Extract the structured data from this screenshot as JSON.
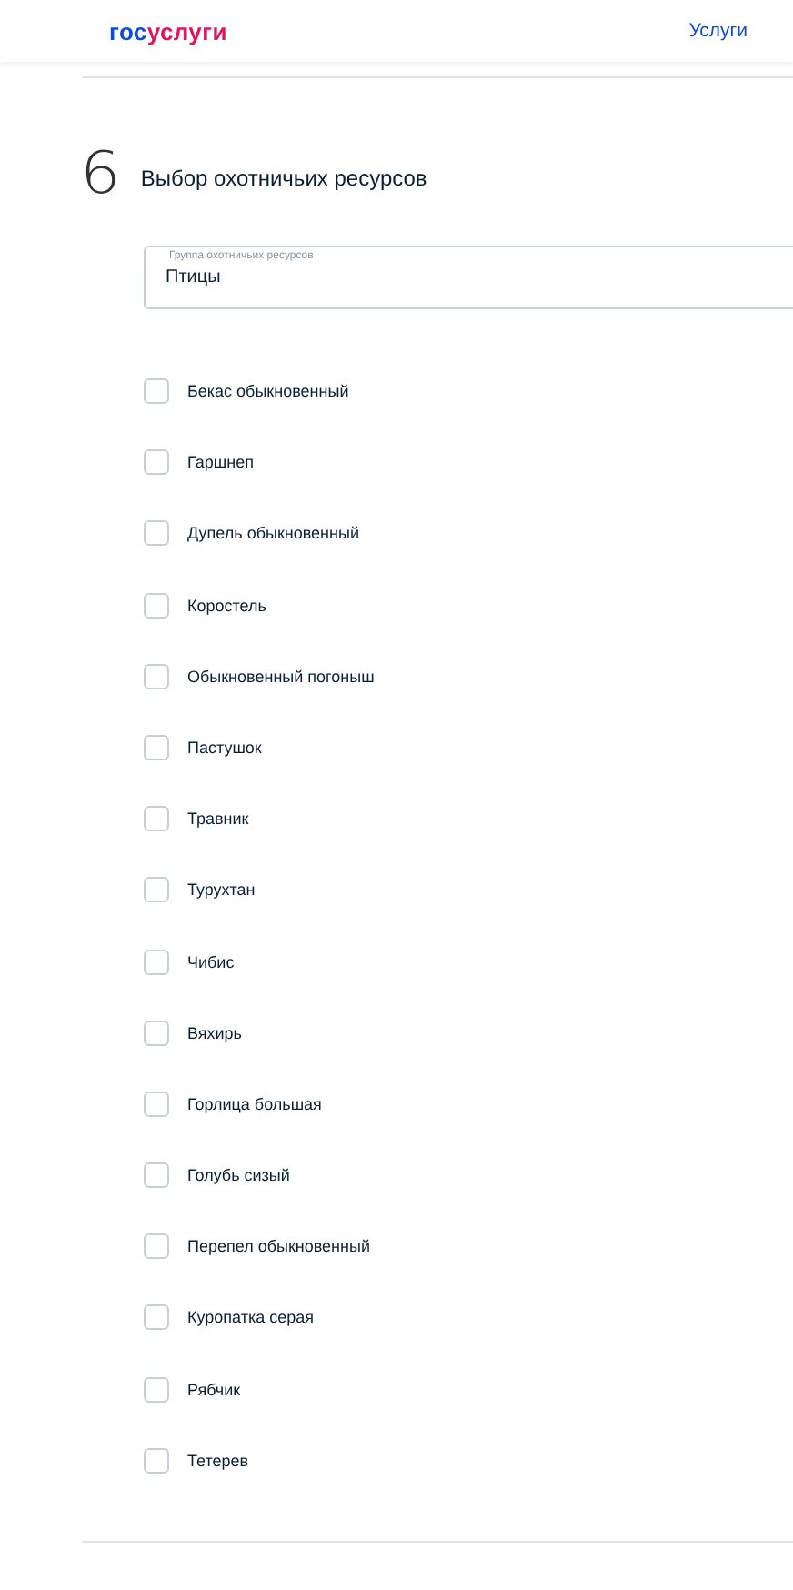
{
  "header": {
    "logo_prefix": "гос",
    "logo_suffix": "услуги",
    "nav_link": "Услуги"
  },
  "step": {
    "number": "6",
    "title": "Выбор охотничьих ресурсов"
  },
  "group_field": {
    "label": "Группа охотничьих ресурсов",
    "value": "Птицы"
  },
  "options": [
    {
      "label": "Бекас обыкновенный",
      "checked": false
    },
    {
      "label": "Гаршнеп",
      "checked": false
    },
    {
      "label": "Дупель обыкновенный",
      "checked": false
    },
    {
      "label": "Коростель",
      "checked": false
    },
    {
      "label": "Обыкновенный погоныш",
      "checked": false
    },
    {
      "label": "Пастушок",
      "checked": false
    },
    {
      "label": "Травник",
      "checked": false
    },
    {
      "label": "Турухтан",
      "checked": false
    },
    {
      "label": "Чибис",
      "checked": false
    },
    {
      "label": "Вяхирь",
      "checked": false
    },
    {
      "label": "Горлица большая",
      "checked": false
    },
    {
      "label": "Голубь сизый",
      "checked": false
    },
    {
      "label": "Перепел обыкновенный",
      "checked": false
    },
    {
      "label": "Куропатка серая",
      "checked": false
    },
    {
      "label": "Рябчик",
      "checked": false
    },
    {
      "label": "Тетерев",
      "checked": false
    }
  ]
}
